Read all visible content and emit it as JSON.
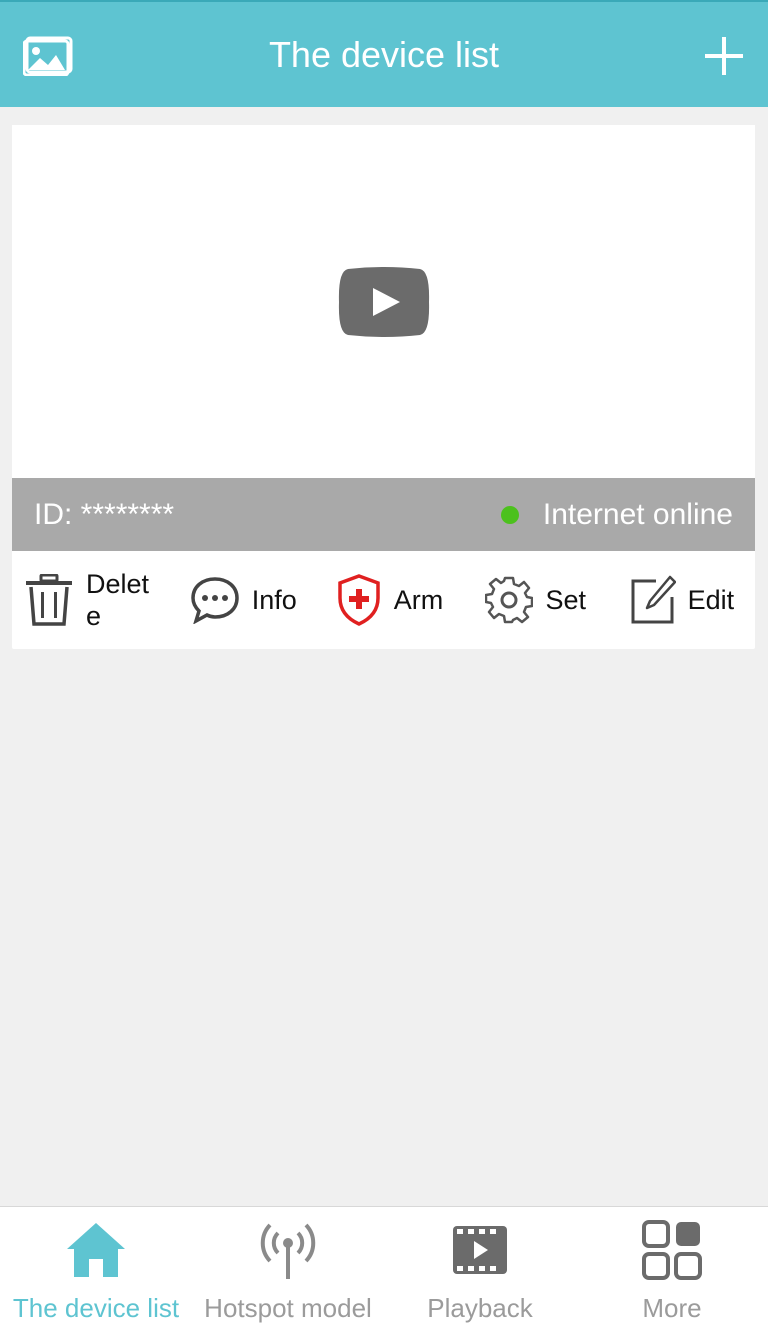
{
  "header": {
    "title": "The device list",
    "left_icon": "gallery-icon",
    "right_icon": "plus-icon"
  },
  "device": {
    "id_label": "ID: ********",
    "status_text": "Internet online",
    "status_color": "#4cc11d",
    "actions": [
      {
        "label": "Delete",
        "icon": "trash-icon"
      },
      {
        "label": "Info",
        "icon": "chat-bubble-icon"
      },
      {
        "label": "Arm",
        "icon": "shield-icon"
      },
      {
        "label": "Set",
        "icon": "gear-icon"
      },
      {
        "label": "Edit",
        "icon": "edit-icon"
      }
    ]
  },
  "bottom_nav": {
    "items": [
      {
        "label": "The device list",
        "icon": "home-icon",
        "active": true
      },
      {
        "label": "Hotspot model",
        "icon": "antenna-icon",
        "active": false
      },
      {
        "label": "Playback",
        "icon": "film-icon",
        "active": false
      },
      {
        "label": "More",
        "icon": "grid-icon",
        "active": false
      }
    ]
  },
  "colors": {
    "accent": "#5ec4d1",
    "status_bar": "#a9a9a9",
    "arm_red": "#e02020",
    "inactive": "#9b9b9b"
  }
}
